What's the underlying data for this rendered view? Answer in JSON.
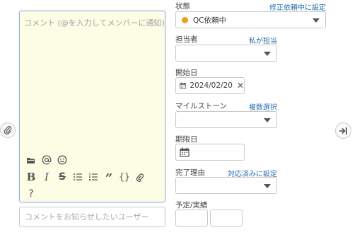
{
  "comment": {
    "placeholder": "コメント (@を入力してメンバーに通知)",
    "notify_placeholder": "コメントをお知らせしたいユーザー",
    "toolbar": {
      "row1": [
        "folder-icon",
        "at-icon",
        "emoji-icon"
      ],
      "row2": [
        "bold-icon",
        "italic-icon",
        "strikethrough-icon",
        "bullet-list-icon",
        "numbered-list-icon",
        "quote-icon",
        "code-icon",
        "link-icon"
      ],
      "row3": [
        "help-icon"
      ]
    }
  },
  "form": {
    "status": {
      "label": "状態",
      "link": "修正依頼中に設定",
      "value": "QC依頼中",
      "color": "#e8a21c"
    },
    "assignee": {
      "label": "担当者",
      "link": "私が担当",
      "value": ""
    },
    "start_date": {
      "label": "開始日",
      "value": "2024/02/20"
    },
    "milestone": {
      "label": "マイルストーン",
      "link": "複数選択",
      "value": ""
    },
    "due_date": {
      "label": "期限日",
      "value": ""
    },
    "resolution": {
      "label": "完了理由",
      "link": "対応済みに設定",
      "value": ""
    },
    "estimate_actual": {
      "label": "予定/実績"
    }
  },
  "colors": {
    "accent_link": "#2a6fb0",
    "editor_bg": "#fdfde5",
    "status_dot": "#e8a21c"
  }
}
